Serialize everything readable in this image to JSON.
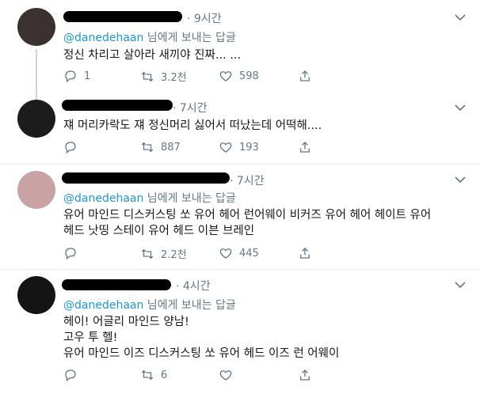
{
  "tweets": [
    {
      "time": "· 9시간",
      "handle": "@danedehaan",
      "reply_suffix": " 님에게 보내는 답글",
      "lines": [
        "정신 차리고 살아라 새끼야 진짜... ..."
      ],
      "replies": "1",
      "retweets": "3.2천",
      "likes": "598"
    },
    {
      "time": "· 7시간",
      "lines": [
        "쟤 머리카락도 쟤 정신머리 싫어서 떠났는데 어떡해...."
      ],
      "replies": "",
      "retweets": "887",
      "likes": "193"
    },
    {
      "time": "· 7시간",
      "handle": "@danedehaan",
      "reply_suffix": " 님에게 보내는 답글",
      "lines": [
        "유어 마인드 디스커스팅 쏘 유어 헤어 런어웨이 비커즈 유어 헤어 헤이트 유어",
        "헤드 낫띵 스테이 유어 헤드 이븐 브레인"
      ],
      "replies": "",
      "retweets": "2.2천",
      "likes": "445"
    },
    {
      "time": "· 4시간",
      "handle": "@danedehaan",
      "reply_suffix": " 님에게 보내는 답글",
      "lines": [
        "헤이! 어글리 마인드 양남!",
        "고우 투 헬!",
        "유어 마인드 이즈 디스커스팅 쏘 유어 헤드 이즈 런 어웨이"
      ],
      "replies": "",
      "retweets": "6",
      "likes": ""
    }
  ],
  "icons": [
    "reply-icon",
    "retweet-icon",
    "like-icon",
    "share-icon",
    "caret-down-icon"
  ],
  "colors": {
    "link": "#1b95e0",
    "muted": "#657786",
    "divider": "#e6ecf0"
  }
}
